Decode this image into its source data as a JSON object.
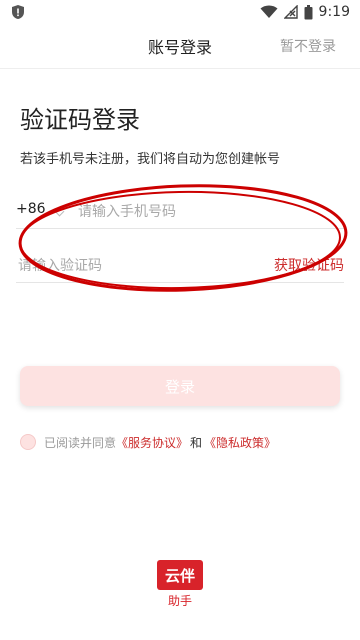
{
  "status_bar": {
    "time": "9:19"
  },
  "header": {
    "title": "账号登录",
    "skip_label": "暂不登录"
  },
  "main": {
    "title": "验证码登录",
    "subtitle": "若该手机号未注册，我们将自动为您创建帐号",
    "phone": {
      "country_code": "+86",
      "placeholder": "请输入手机号码",
      "value": ""
    },
    "code": {
      "placeholder": "请输入验证码",
      "value": "",
      "get_code_label": "获取验证码"
    },
    "login_label": "登录",
    "agreement": {
      "prefix": "已阅读并同意",
      "service_link": "《服务协议》",
      "and": "和",
      "privacy_link": "《隐私政策》",
      "checked": false
    }
  },
  "footer": {
    "logo_text": "云伴",
    "logo_sub": "助手"
  },
  "colors": {
    "accent": "#cc2d2d",
    "button_bg": "#fde2e1",
    "annotation": "#cc0000"
  },
  "icons": [
    "shield-icon",
    "wifi-icon",
    "signal-icon",
    "battery-icon"
  ]
}
